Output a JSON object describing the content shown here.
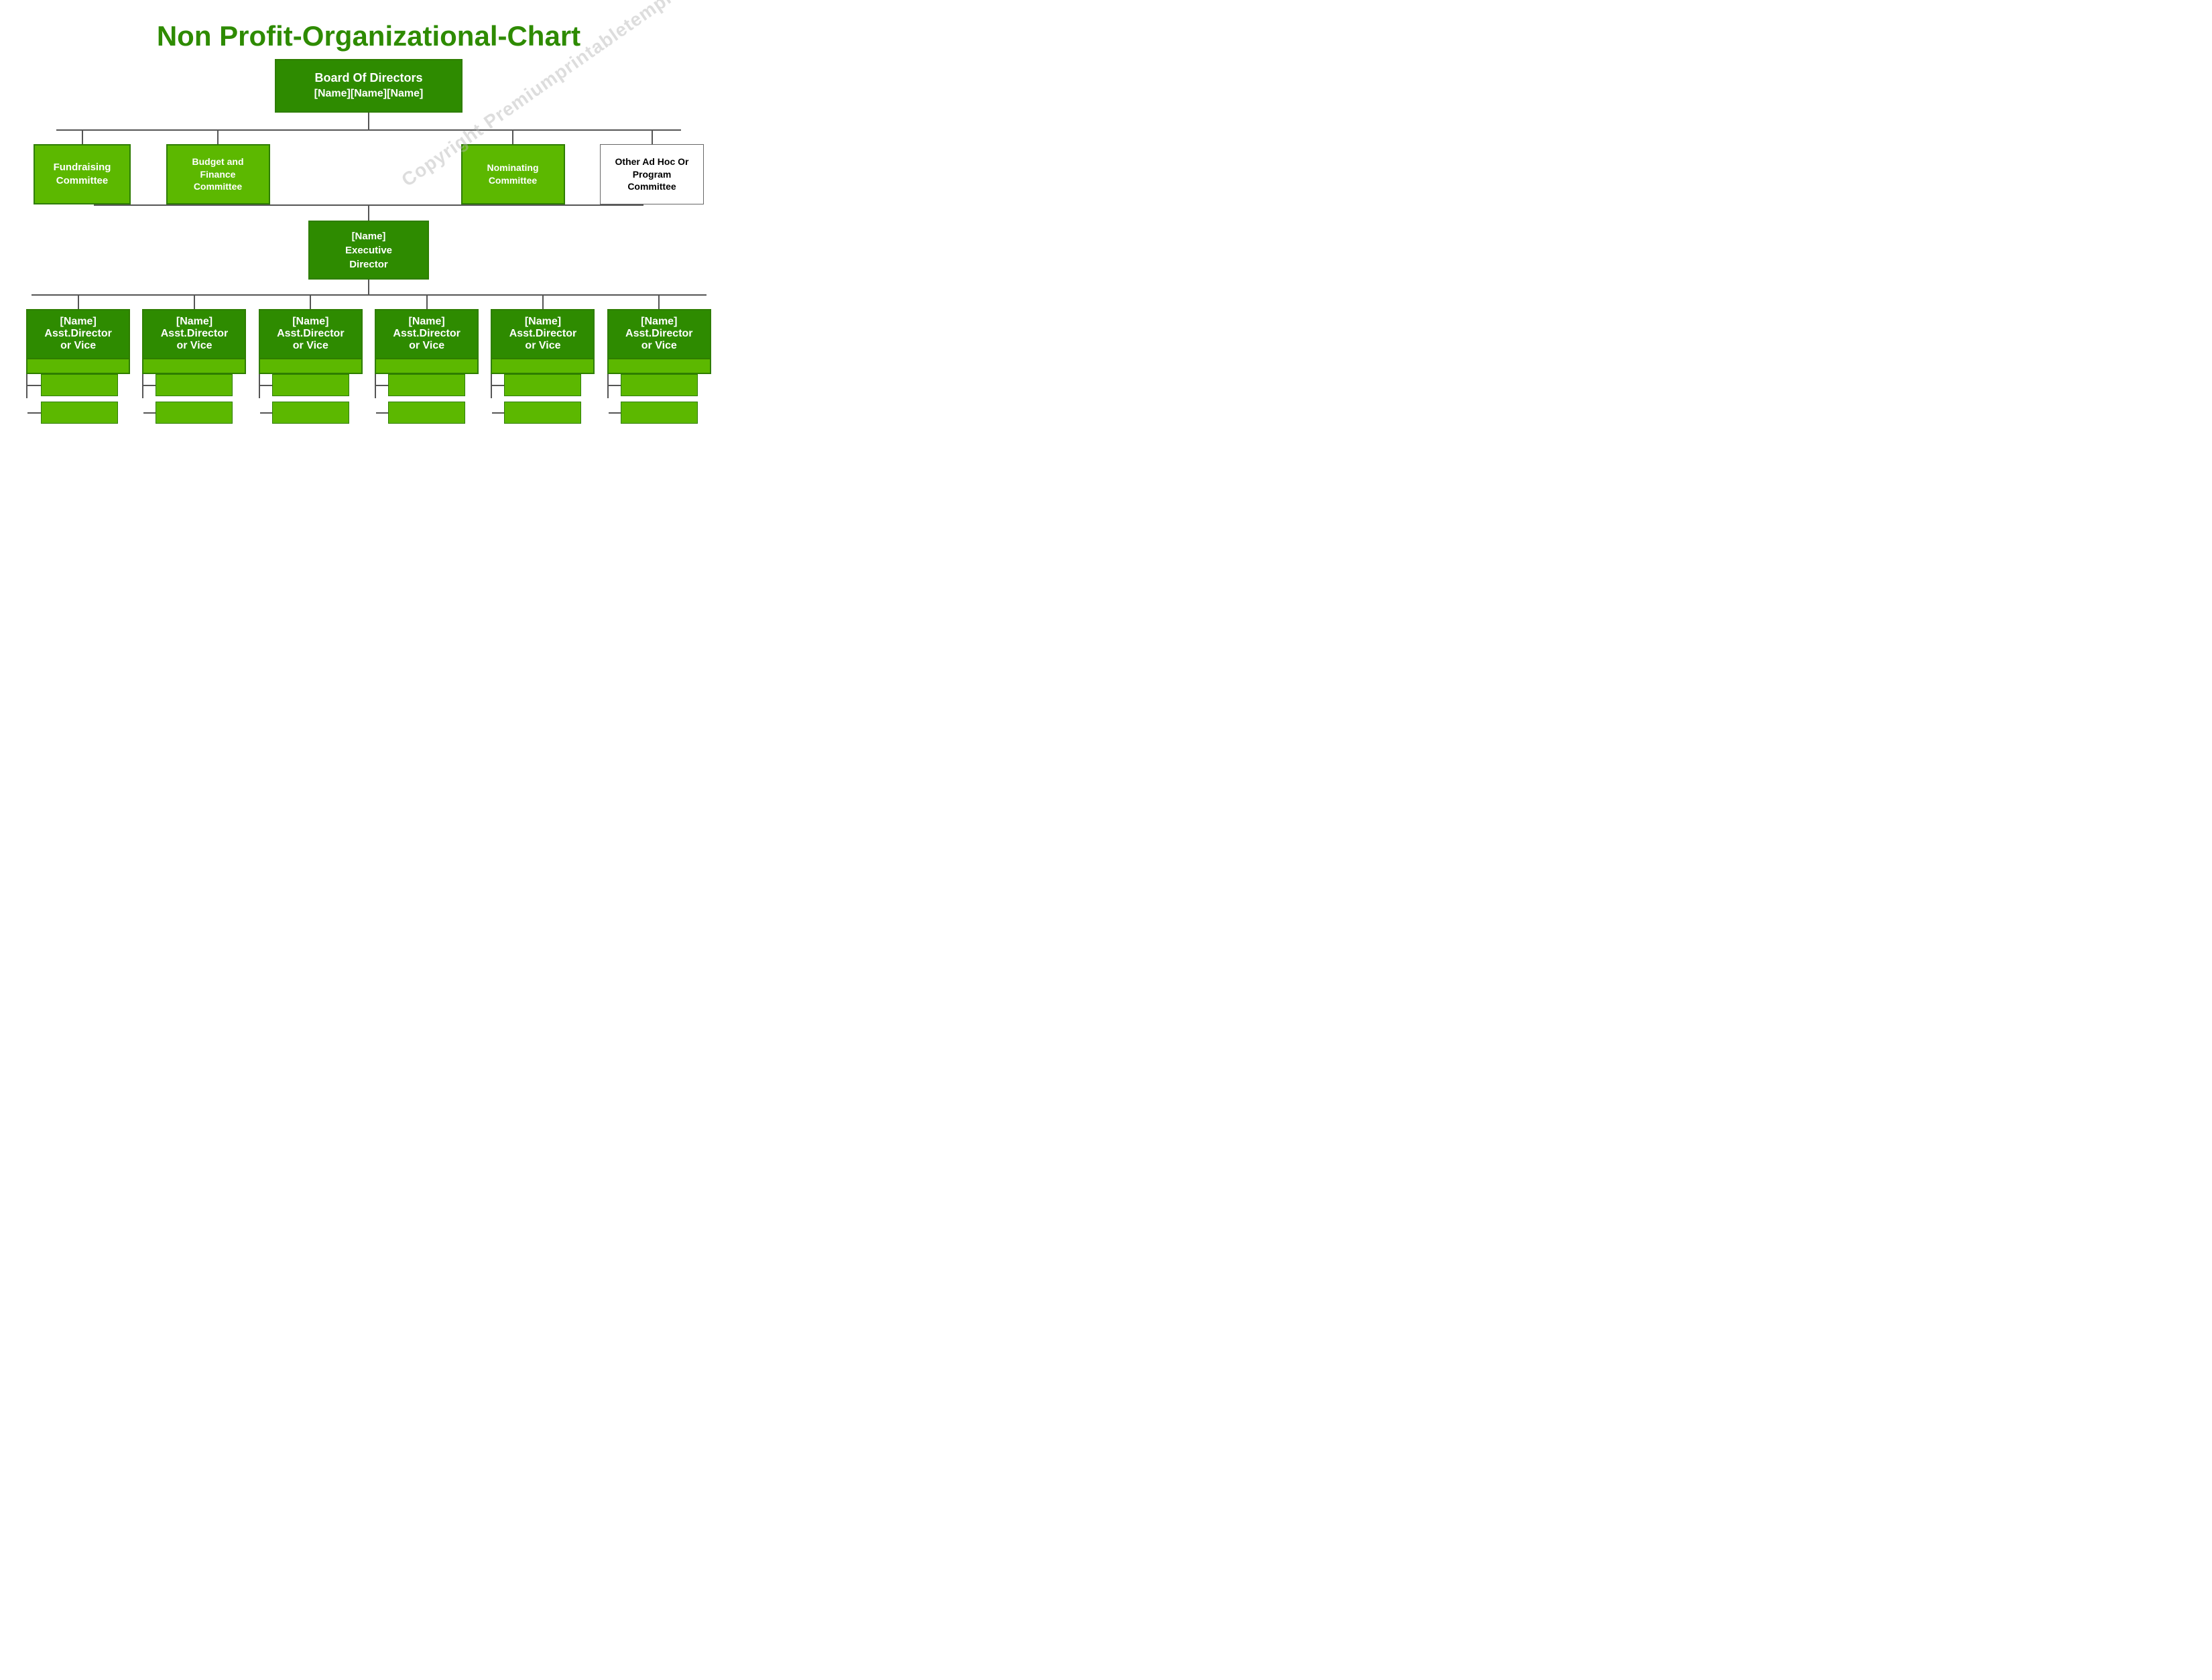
{
  "title": "Non Profit-Organizational-Chart",
  "watermark": "Copyright Premiumprintabletemplates.com",
  "board": {
    "line1": "Board Of Directors",
    "line2": "[Name][Name][Name]"
  },
  "committees": [
    {
      "label": "Fundraising\nCommittee",
      "type": "light"
    },
    {
      "label": "Budget and\nFinance\nCommittee",
      "type": "light"
    },
    {
      "label": "Nominating\nCommittee",
      "type": "light"
    },
    {
      "label": "Other Ad Hoc Or\nProgram\nCommittee",
      "type": "white"
    }
  ],
  "executive": {
    "label": "[Name]\nExecutive\nDirector"
  },
  "assistants": [
    {
      "name": "[Name]",
      "title": "Asst.Director\nor Vice"
    },
    {
      "name": "[Name]",
      "title": "Asst.Director\nor Vice"
    },
    {
      "name": "[Name]",
      "title": "Asst.Director\nor Vice"
    },
    {
      "name": "[Name]",
      "title": "Asst.Director\nor Vice"
    },
    {
      "name": "[Name]",
      "title": "Asst.Director\nor Vice"
    },
    {
      "name": "[Name]",
      "title": "Asst.Director\nor Vice"
    }
  ]
}
